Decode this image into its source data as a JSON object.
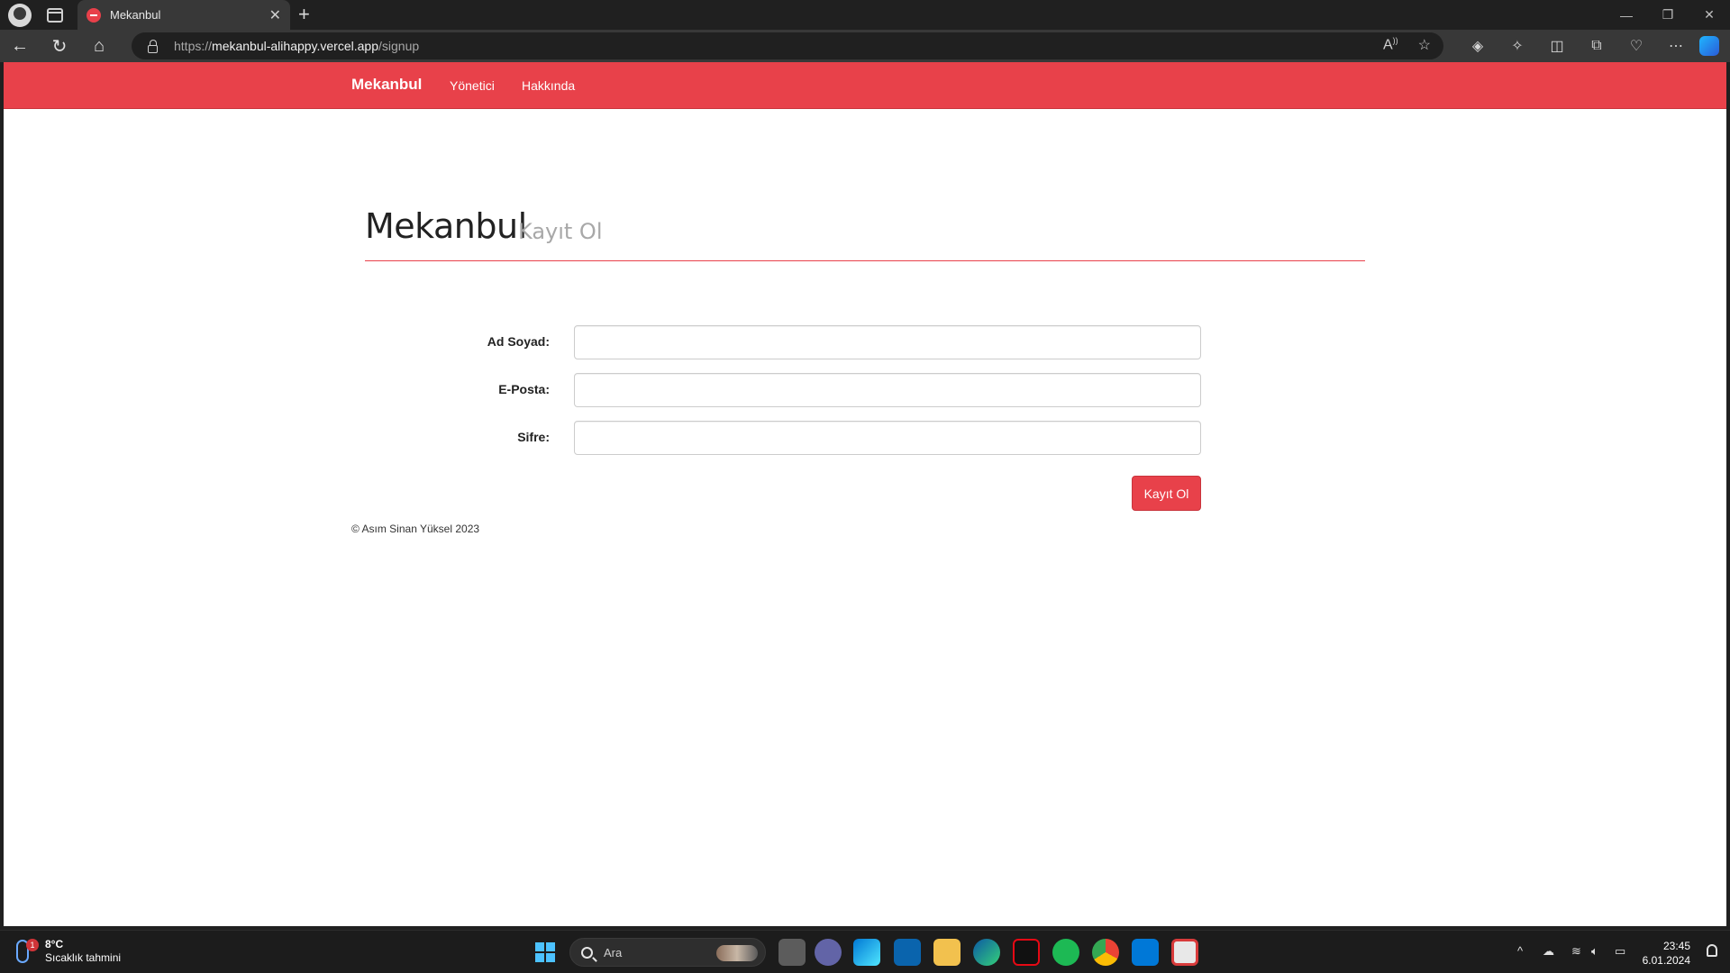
{
  "browser": {
    "tab_title": "Mekanbul",
    "url_scheme": "https://",
    "url_host": "mekanbul-alihappy.vercel.app",
    "url_path": "/signup"
  },
  "navbar": {
    "brand": "Mekanbul",
    "links": [
      "Yönetici",
      "Hakkında"
    ],
    "color": "#e8414a"
  },
  "page": {
    "title": "Mekanbul",
    "subtitle": "Kayıt Ol"
  },
  "form": {
    "fields": [
      {
        "label": "Ad Soyad:",
        "value": ""
      },
      {
        "label": "E-Posta:",
        "value": ""
      },
      {
        "label": "Sifre:",
        "value": ""
      }
    ],
    "submit_label": "Kayıt Ol"
  },
  "footer": {
    "text": "© Asım Sinan Yüksel 2023"
  },
  "taskbar": {
    "weather_temp": "8°C",
    "weather_desc": "Sıcaklık tahmini",
    "weather_badge": "1",
    "search_placeholder": "Ara",
    "time": "23:45",
    "date": "6.01.2024"
  }
}
